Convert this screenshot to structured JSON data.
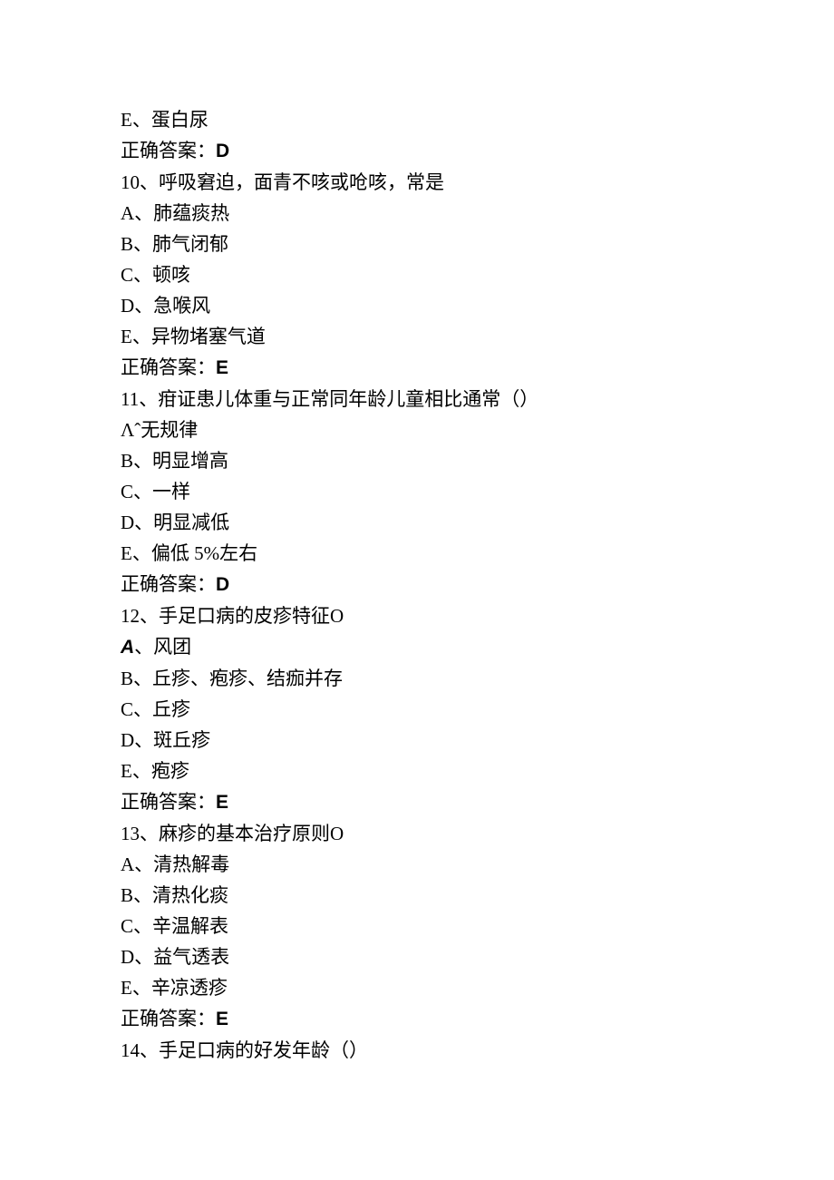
{
  "lines": [
    {
      "text": "E、蛋白尿"
    },
    {
      "prefix": "正确答案：",
      "bold": "D"
    },
    {
      "text": "10、呼吸窘迫，面青不咳或呛咳，常是"
    },
    {
      "text": "A、肺蕴痰热"
    },
    {
      "text": "B、肺气闭郁"
    },
    {
      "text": "C、顿咳"
    },
    {
      "text": "D、急喉风"
    },
    {
      "text": "E、异物堵塞气道"
    },
    {
      "prefix": "正确答案：",
      "bold": "E"
    },
    {
      "text": "11、疳证患儿体重与正常同年龄儿童相比通常（）"
    },
    {
      "text": "Λˆ无规律"
    },
    {
      "text": "B、明显增高"
    },
    {
      "text": "C、一样"
    },
    {
      "text": "D、明显减低"
    },
    {
      "text": "E、偏低 5%左右"
    },
    {
      "prefix": "正确答案：",
      "bold": "D"
    },
    {
      "text": "12、手足口病的皮疹特征O"
    },
    {
      "italicA": "A",
      "suffix": "、风团"
    },
    {
      "text": "B、丘疹、疱疹、结痂并存"
    },
    {
      "text": "C、丘疹"
    },
    {
      "text": "D、斑丘疹"
    },
    {
      "text": "E、疱疹"
    },
    {
      "prefix": "正确答案：",
      "bold": "E"
    },
    {
      "text": "13、麻疹的基本治疗原则O"
    },
    {
      "text": "A、清热解毒"
    },
    {
      "text": "B、清热化痰"
    },
    {
      "text": "C、辛温解表"
    },
    {
      "text": "D、益气透表"
    },
    {
      "text": "E、辛凉透疹"
    },
    {
      "prefix": "正确答案：",
      "bold": "E"
    },
    {
      "text": "14、手足口病的好发年龄（）"
    }
  ]
}
